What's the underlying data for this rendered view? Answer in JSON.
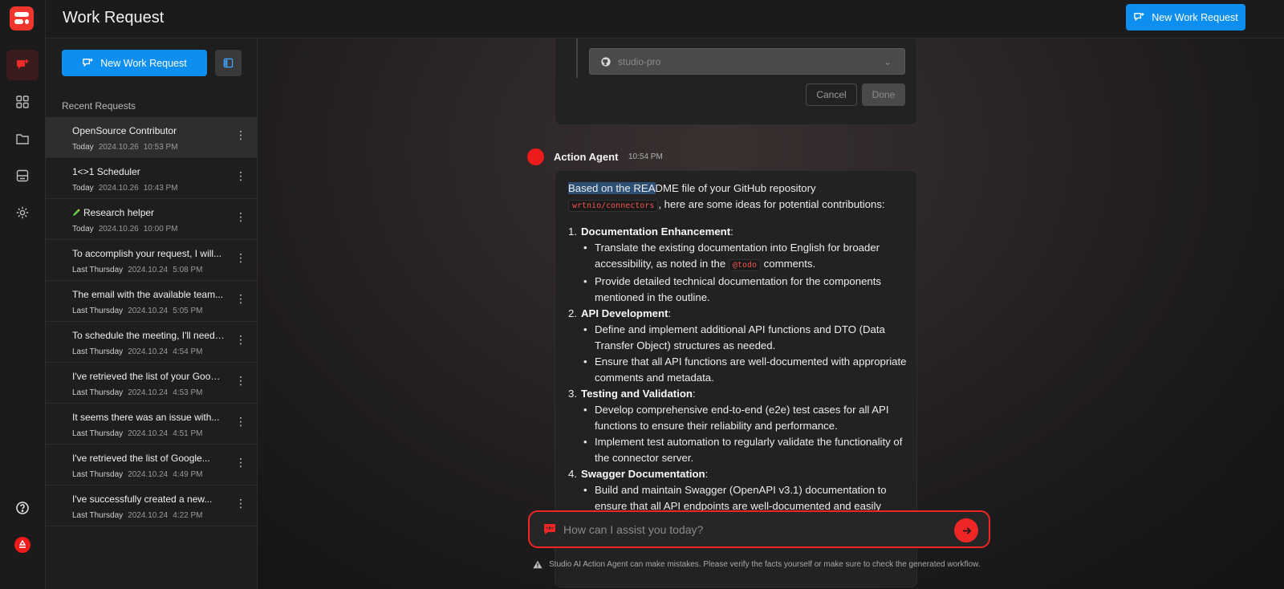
{
  "header": {
    "title": "Work Request",
    "new_button_label": "New Work Request"
  },
  "panel": {
    "new_button_label": "New Work Request",
    "recent_title": "Recent Requests",
    "requests": [
      {
        "title": "OpenSource Contributor",
        "day": "Today",
        "date": "2024.10.26",
        "time": "10:53 PM",
        "active": true
      },
      {
        "title": "1<>1 Scheduler",
        "day": "Today",
        "date": "2024.10.26",
        "time": "10:43 PM"
      },
      {
        "title": "Research helper",
        "day": "Today",
        "date": "2024.10.26",
        "time": "10:00 PM",
        "emoji": "pencil"
      },
      {
        "title": "To accomplish your request, I will...",
        "day": "Last Thursday",
        "date": "2024.10.24",
        "time": "5:08 PM"
      },
      {
        "title": "The email with the available team...",
        "day": "Last Thursday",
        "date": "2024.10.24",
        "time": "5:05 PM"
      },
      {
        "title": "To schedule the meeting, I'll need ...",
        "day": "Last Thursday",
        "date": "2024.10.24",
        "time": "4:54 PM"
      },
      {
        "title": "I've retrieved the list of your Googl...",
        "day": "Last Thursday",
        "date": "2024.10.24",
        "time": "4:53 PM"
      },
      {
        "title": "It seems there was an issue with...",
        "day": "Last Thursday",
        "date": "2024.10.24",
        "time": "4:51 PM"
      },
      {
        "title": "I've retrieved the list of Google...",
        "day": "Last Thursday",
        "date": "2024.10.24",
        "time": "4:49 PM"
      },
      {
        "title": "I've successfully created a new...",
        "day": "Last Thursday",
        "date": "2024.10.24",
        "time": "4:22 PM"
      }
    ]
  },
  "repo_card": {
    "selected_repo": "studio-pro",
    "cancel_label": "Cancel",
    "done_label": "Done"
  },
  "agent": {
    "name": "Action Agent",
    "time": "10:54 PM",
    "intro_highlight": "Based on the REA",
    "intro_rest": "DME file of your GitHub repository",
    "repo_code": "wrtnio/connectors",
    "intro_tail": ", here are some ideas for potential contributions:",
    "items": [
      {
        "num": "1.",
        "title": "Documentation Enhancement",
        "bullets": [
          {
            "before": "Translate the existing documentation into English for broader accessibility, as noted in the ",
            "code": "@todo",
            "after": " comments."
          },
          {
            "before": "Provide detailed technical documentation for the components mentioned in the outline."
          }
        ]
      },
      {
        "num": "2.",
        "title": "API Development",
        "bullets": [
          {
            "before": "Define and implement additional API functions and DTO (Data Transfer Object) structures as needed."
          },
          {
            "before": "Ensure that all API functions are well-documented with appropriate comments and metadata."
          }
        ]
      },
      {
        "num": "3.",
        "title": "Testing and Validation",
        "bullets": [
          {
            "before": "Develop comprehensive end-to-end (e2e) test cases for all API functions to ensure their reliability and performance."
          },
          {
            "before": "Implement test automation to regularly validate the functionality of the connector server."
          }
        ]
      },
      {
        "num": "4.",
        "title": "Swagger Documentation",
        "bullets": [
          {
            "before": "Build and maintain Swagger (OpenAPI v3.1) documentation to ensure that all API endpoints are well-documented and easily accessible."
          }
        ]
      }
    ]
  },
  "composer": {
    "placeholder": "How can I assist you today?",
    "disclaimer": "Studio AI Action Agent can make mistakes. Please verify the facts yourself or make sure to check the generated workflow."
  },
  "colors": {
    "accent": "#0d8ff2",
    "brand": "#ee2626"
  }
}
